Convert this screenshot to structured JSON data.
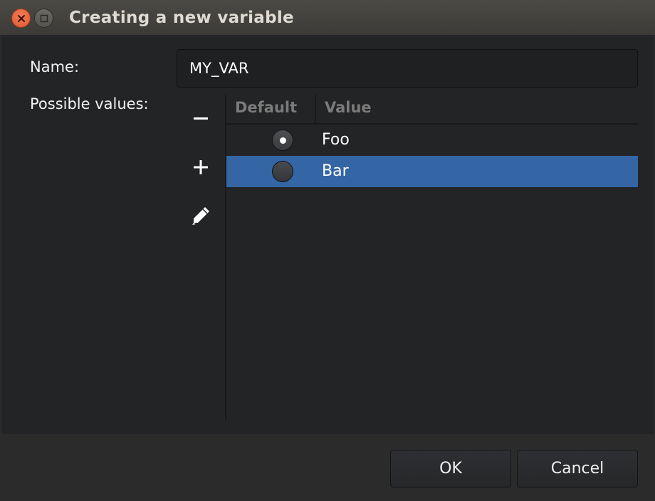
{
  "window": {
    "title": "Creating a new variable",
    "close_icon": "close-icon",
    "maximize_icon": "maximize-icon"
  },
  "form": {
    "name_label": "Name:",
    "name_value": "MY_VAR",
    "values_label": "Possible values:"
  },
  "toolbar": {
    "remove_icon": "minus-icon",
    "add_icon": "plus-icon",
    "edit_icon": "pencil-icon"
  },
  "table": {
    "columns": [
      "Default",
      "Value"
    ],
    "rows": [
      {
        "default": true,
        "value": "Foo",
        "selected": false
      },
      {
        "default": false,
        "value": "Bar",
        "selected": true
      }
    ]
  },
  "buttons": {
    "ok_label": "OK",
    "cancel_label": "Cancel"
  },
  "colors": {
    "selection": "#3465a4",
    "close_button": "#e05a2e"
  }
}
